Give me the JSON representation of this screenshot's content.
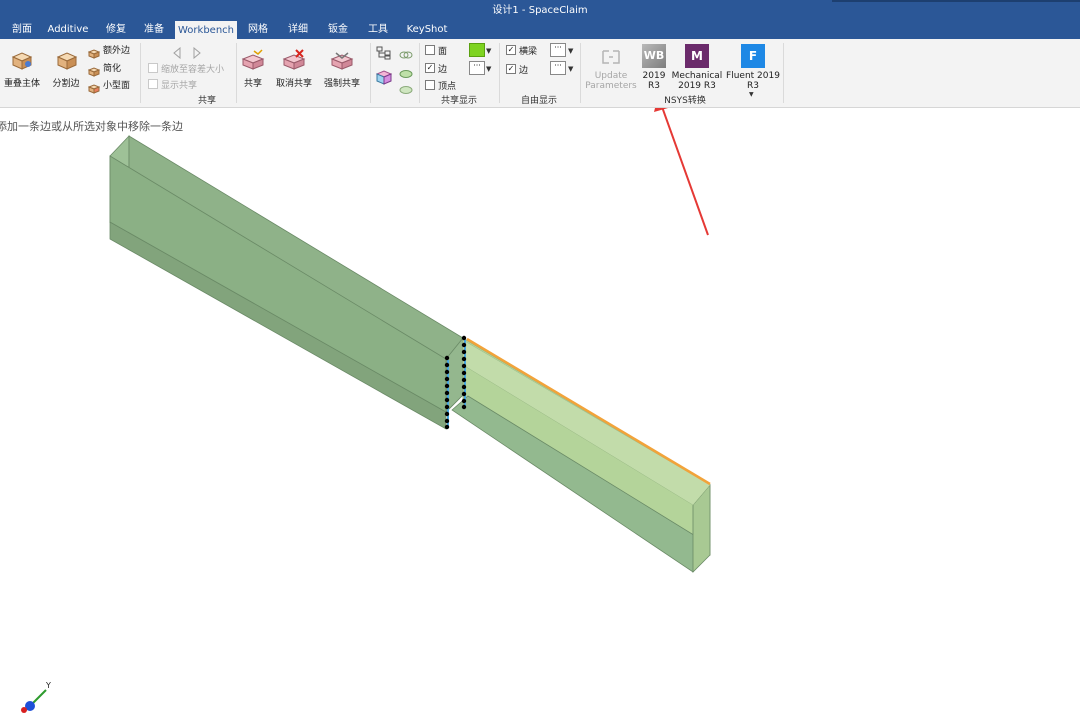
{
  "window": {
    "title": "设计1 - SpaceClaim"
  },
  "tabs": [
    {
      "label": "剖面"
    },
    {
      "label": "Additive"
    },
    {
      "label": "修复"
    },
    {
      "label": "准备"
    },
    {
      "label": "Workbench"
    },
    {
      "label": "网格"
    },
    {
      "label": "详细"
    },
    {
      "label": "钣金"
    },
    {
      "label": "工具"
    },
    {
      "label": "KeyShot"
    }
  ],
  "ribbon": {
    "overlap_label": "重叠主体",
    "split_edge_label": "分割边",
    "extra_edge_label": "额外边",
    "simplify_label": "简化",
    "small_face_label": "小型面",
    "zoom_to_share_label": "缩放至容差大小",
    "show_share_label": "显示共享",
    "share_label": "共享",
    "unshare_label": "取消共享",
    "force_share_label": "强制共享",
    "share_group_label": "共享",
    "face_label": "面",
    "edge_label": "边",
    "vertex_label": "顶点",
    "share_display_label": "共享显示",
    "beam_label": "横梁",
    "free_edge_label": "边",
    "free_display_label": "自由显示",
    "update_line1": "Update",
    "update_line2": "Parameters",
    "wb_line1": "2019",
    "wb_line2": "R3",
    "mech_line1": "Mechanical",
    "mech_line2": "2019 R3",
    "fluent_line1": "Fluent 2019",
    "fluent_line2": "R3",
    "ansys_group_label": "NSYS转换",
    "wb_icon_text": "WB",
    "mech_icon_text": "M",
    "fluent_icon_text": "F"
  },
  "status": {
    "hint": "添加一条边或从所选对象中移除一条边"
  },
  "axis_triad": {
    "y_label": "Y"
  },
  "colors": {
    "accent": "#2b5797",
    "body_green": "#93b98f",
    "highlight_green": "#b4d49a",
    "selected_edge": "#f2a33a",
    "arrow": "#e53935"
  }
}
